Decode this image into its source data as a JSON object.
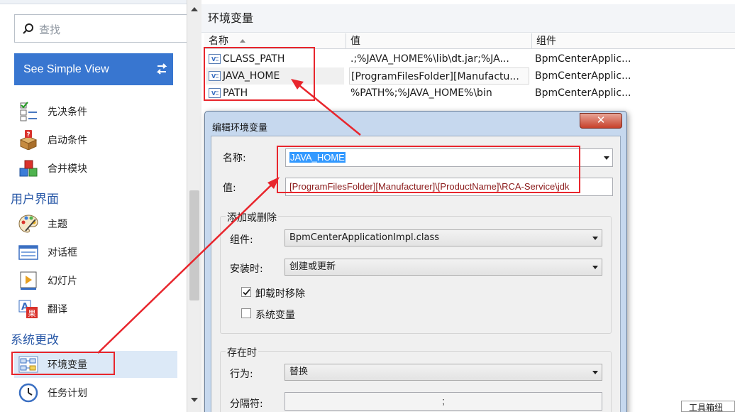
{
  "sidebar": {
    "search_placeholder": "查找",
    "simple_view_label": "See Simple View",
    "items_top": [
      {
        "label": "先决条件",
        "icon": "checklist-icon"
      },
      {
        "label": "启动条件",
        "icon": "box-question-icon"
      },
      {
        "label": "合并模块",
        "icon": "module-cubes-icon"
      }
    ],
    "section_ui": "用户界面",
    "items_ui": [
      {
        "label": "主题",
        "icon": "palette-icon"
      },
      {
        "label": "对话框",
        "icon": "dialog-window-icon"
      },
      {
        "label": "幻灯片",
        "icon": "slideshow-icon"
      },
      {
        "label": "翻译",
        "icon": "translate-icon"
      }
    ],
    "section_system": "系统更改",
    "items_system": [
      {
        "label": "环境变量",
        "icon": "env-variables-icon",
        "active": true
      },
      {
        "label": "任务计划",
        "icon": "clock-icon"
      }
    ]
  },
  "main": {
    "title": "环境变量",
    "columns": [
      "名称",
      "值",
      "组件"
    ],
    "rows": [
      {
        "name": "CLASS_PATH",
        "value": ".;%JAVA_HOME%\\lib\\dt.jar;%JA...",
        "component": "BpmCenterApplic..."
      },
      {
        "name": "JAVA_HOME",
        "value": "[ProgramFilesFolder][Manufactu...",
        "component": "BpmCenterApplic..."
      },
      {
        "name": "PATH",
        "value": "%PATH%;%JAVA_HOME%\\bin",
        "component": "BpmCenterApplic..."
      }
    ]
  },
  "dialog": {
    "title": "编辑环境变量",
    "close_label": "✕",
    "name_label": "名称:",
    "name_value": "JAVA_HOME",
    "value_label": "值:",
    "value_value": "[ProgramFilesFolder][Manufacturer]\\[ProductName]\\RCA-Service\\jdk",
    "group_add_title": "添加或删除",
    "component_label": "组件:",
    "component_value": "BpmCenterApplicationImpl.class",
    "install_label": "安装时:",
    "install_value": "创建或更新",
    "uninstall_remove_label": "卸载时移除",
    "uninstall_remove_checked": true,
    "system_var_label": "系统变量",
    "system_var_checked": false,
    "group_exist_title": "存在时",
    "behavior_label": "行为:",
    "behavior_value": "替换",
    "separator_label": "分隔符:",
    "separator_value": ";"
  },
  "partial_tooltip": "工具箱纽",
  "colors": {
    "accent": "#3876d0",
    "annotation_red": "#e8262d",
    "section_blue": "#2b5aa8",
    "active_row": "#dce9f7"
  }
}
